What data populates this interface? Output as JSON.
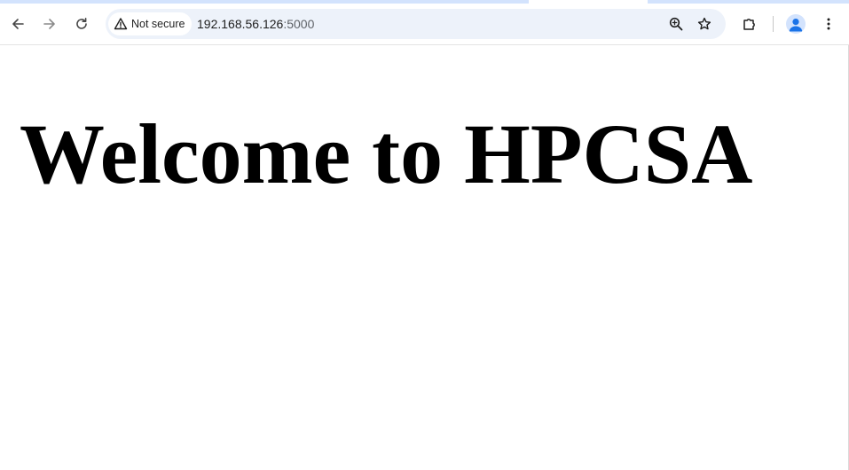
{
  "browser": {
    "nav": {
      "back_icon": "arrow-back-icon",
      "forward_icon": "arrow-forward-icon",
      "reload_icon": "reload-icon"
    },
    "address_bar": {
      "security_label": "Not secure",
      "security_icon": "warning-triangle-icon",
      "url_host": "192.168.56.126",
      "url_port": ":5000",
      "zoom_icon": "zoom-in-icon",
      "bookmark_icon": "star-outline-icon"
    },
    "toolbar": {
      "extensions_icon": "puzzle-piece-icon",
      "profile_icon": "profile-avatar-icon",
      "menu_icon": "more-vertical-icon"
    },
    "colors": {
      "tabstrip": "#d3e3fd",
      "omnibox": "#edf2fa",
      "avatar": "#1a73e8"
    }
  },
  "page": {
    "heading": "Welcome to HPCSA"
  }
}
